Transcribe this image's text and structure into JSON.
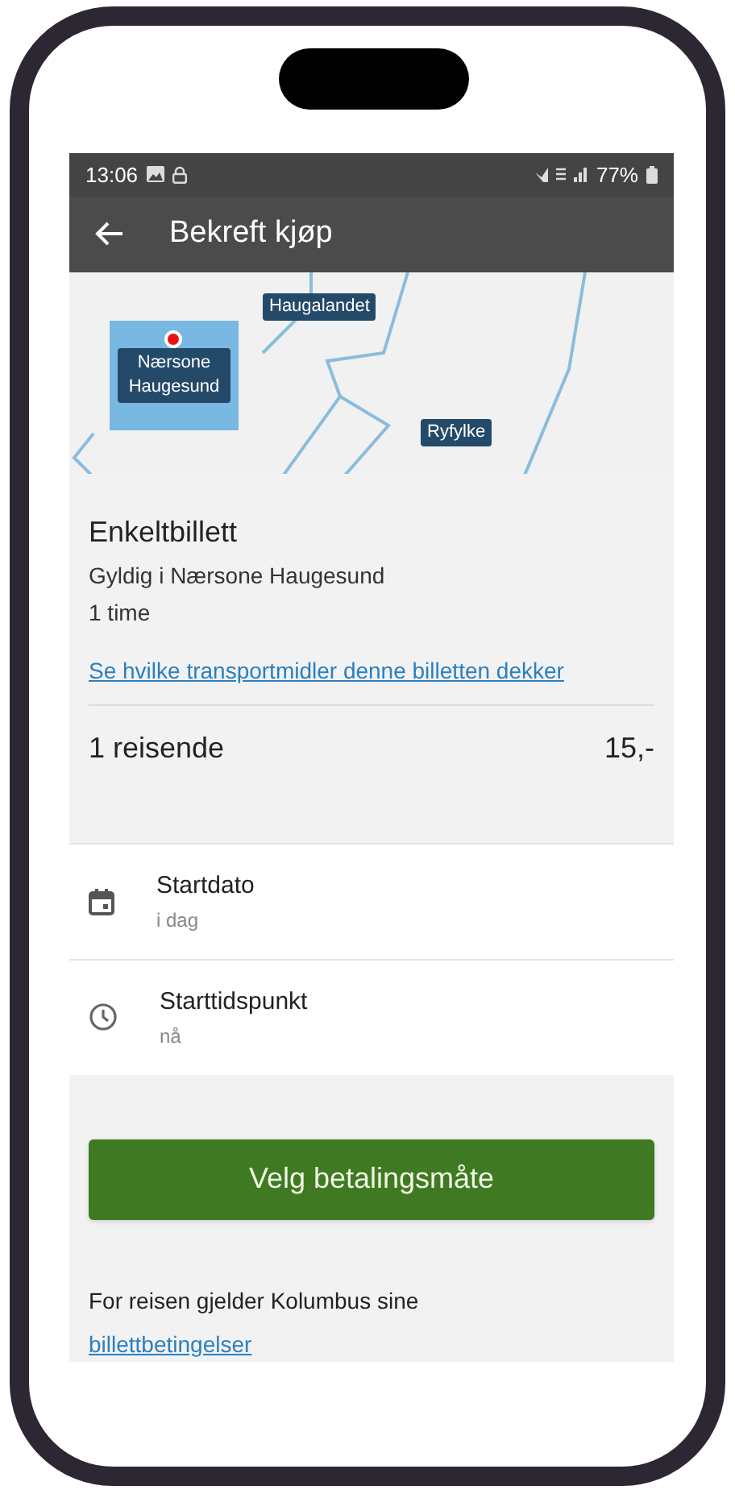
{
  "status_bar": {
    "time": "13:06",
    "battery": "77%"
  },
  "header": {
    "title": "Bekreft kjøp"
  },
  "map": {
    "zones": [
      {
        "label": "Nærsone Haugesund",
        "selected": true
      },
      {
        "label": "Haugalandet",
        "selected": false
      },
      {
        "label": "Ryfylke",
        "selected": false
      }
    ]
  },
  "ticket": {
    "title": "Enkeltbillett",
    "validity": "Gyldig i Nærsone Haugesund",
    "duration": "1 time",
    "link": "Se hvilke transportmidler denne billetten dekker",
    "travellers": "1 reisende",
    "price": "15,-"
  },
  "options": [
    {
      "kind": "date",
      "label": "Startdato",
      "value": "i dag"
    },
    {
      "kind": "time",
      "label": "Starttidspunkt",
      "value": "nå"
    }
  ],
  "pay_button": "Velg betalingsmåte",
  "terms": {
    "text": "For reisen gjelder Kolumbus sine",
    "link": "billettbetingelser"
  }
}
